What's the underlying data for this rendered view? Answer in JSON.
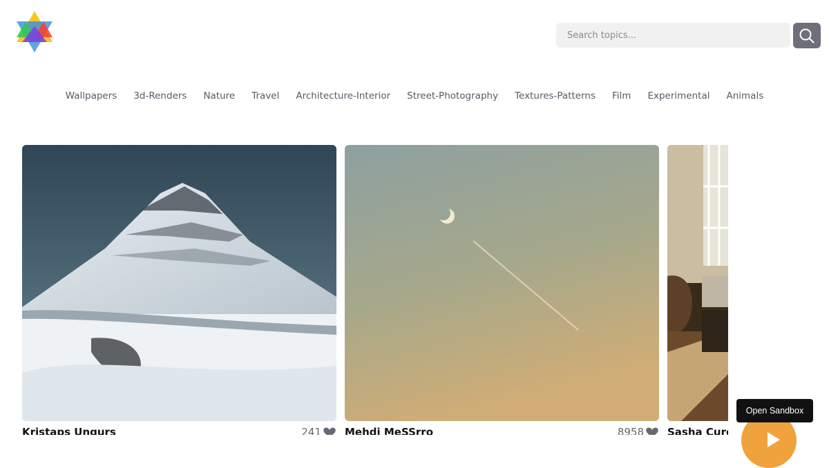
{
  "header": {
    "logo_icon": "multicolor-star-logo",
    "search": {
      "placeholder": "Search topics...",
      "value": "",
      "icon": "search-icon"
    }
  },
  "topics": [
    {
      "label": "Wallpapers"
    },
    {
      "label": "3d-Renders"
    },
    {
      "label": "Nature"
    },
    {
      "label": "Travel"
    },
    {
      "label": "Architecture-Interior"
    },
    {
      "label": "Street-Photography"
    },
    {
      "label": "Textures-Patterns"
    },
    {
      "label": "Film"
    },
    {
      "label": "Experimental"
    },
    {
      "label": "Animals"
    }
  ],
  "gallery": {
    "cards": [
      {
        "author": "Kristaps Ungurs",
        "likes": "241",
        "photo": "snowy-mountain-photo"
      },
      {
        "author": "Mehdi MeSSrro",
        "likes": "8958",
        "photo": "crescent-moon-contrail-photo"
      },
      {
        "author": "Sasha Curcic",
        "photo": "sunlit-interior-window-photo"
      }
    ]
  },
  "sandbox": {
    "tooltip": "Open Sandbox",
    "icon": "play-icon"
  },
  "colors": {
    "search_button": "#6e6f7a",
    "fab": "#f0a23c",
    "tooltip_bg": "#111111"
  }
}
